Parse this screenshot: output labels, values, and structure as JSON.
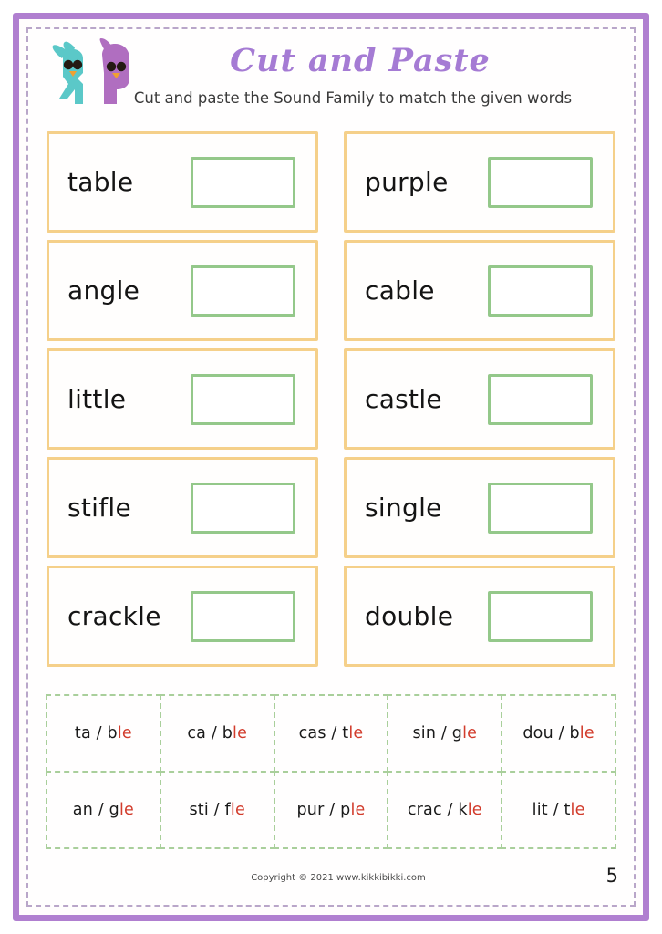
{
  "header": {
    "title": "Cut and Paste",
    "subtitle": "Cut and paste the Sound Family to match the given words",
    "logo_alt": "kikkibikki-birds-logo"
  },
  "theme": {
    "page_border": "#b07fd0",
    "card_border": "#f5d08a",
    "answer_box_border": "#94c88a",
    "tile_border": "#a9cf9b",
    "title_color": "#a57bd4",
    "highlight_color": "#d23c2c",
    "logo_teal": "#5bc8c8",
    "logo_purple": "#b06ec0",
    "logo_beak": "#f0a030"
  },
  "word_cards": [
    {
      "word": "table"
    },
    {
      "word": "purple"
    },
    {
      "word": "angle"
    },
    {
      "word": "cable"
    },
    {
      "word": "little"
    },
    {
      "word": "castle"
    },
    {
      "word": "stifle"
    },
    {
      "word": "single"
    },
    {
      "word": "crackle"
    },
    {
      "word": "double"
    }
  ],
  "tiles": [
    {
      "prefix": "ta / b",
      "suffix": "le"
    },
    {
      "prefix": "ca / b",
      "suffix": "le"
    },
    {
      "prefix": "cas / t",
      "suffix": "le"
    },
    {
      "prefix": "sin / g",
      "suffix": "le"
    },
    {
      "prefix": "dou / b",
      "suffix": "le"
    },
    {
      "prefix": "an / g",
      "suffix": "le"
    },
    {
      "prefix": "sti / f",
      "suffix": "le"
    },
    {
      "prefix": "pur / p",
      "suffix": "le"
    },
    {
      "prefix": "crac / k",
      "suffix": "le"
    },
    {
      "prefix": "lit / t",
      "suffix": "le"
    }
  ],
  "footer": {
    "copyright": "Copyright © 2021 www.kikkibikki.com",
    "page_number": "5"
  }
}
